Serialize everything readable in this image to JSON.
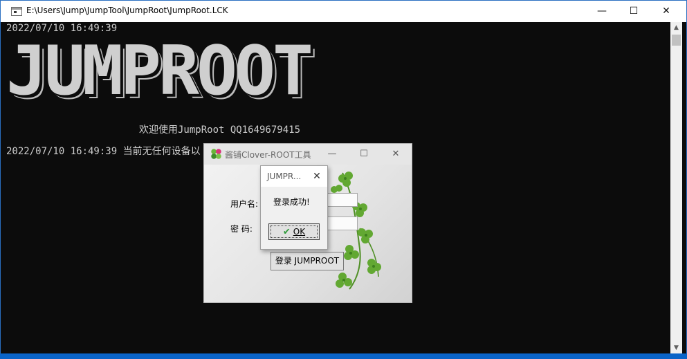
{
  "console_window": {
    "title": "E:\\Users\\Jump\\JumpTool\\JumpRoot\\JumpRoot.LCK",
    "controls": {
      "minimize": "—",
      "maximize": "☐",
      "close": "✕"
    },
    "lines": [
      "2022/07/10 16:49:39",
      "欢迎使用JumpRoot QQ1649679415",
      "2022/07/10 16:49:39 当前无任何设备以"
    ],
    "banner": "JUMPROOT",
    "scroll_up": "▲",
    "scroll_down": "▼"
  },
  "app_window": {
    "title": "酱铺Clover-ROOT工具",
    "controls": {
      "minimize": "—",
      "maximize": "☐",
      "close": "✕"
    },
    "username_label": "用户名:",
    "password_label": "密  码:",
    "login_button": "登录 JUMPROOT"
  },
  "message_box": {
    "title": "JUMPR...",
    "close": "✕",
    "message": "登录成功!",
    "ok_label": "OK",
    "ok_icon": "✔"
  },
  "colors": {
    "console_bg": "#0c0c0c",
    "console_text": "#cccccc",
    "accent": "#0a64c8",
    "clover_green": "#5aa02c"
  }
}
